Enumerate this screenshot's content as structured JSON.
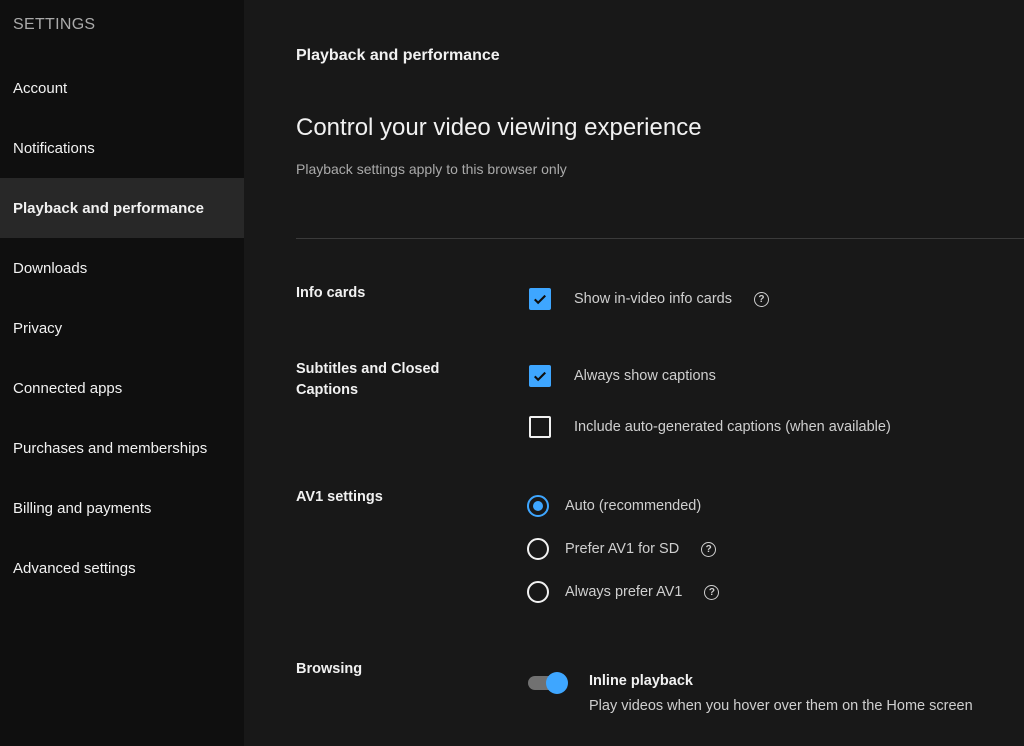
{
  "sidebar": {
    "heading": "SETTINGS",
    "items": [
      {
        "label": "Account"
      },
      {
        "label": "Notifications"
      },
      {
        "label": "Playback and performance"
      },
      {
        "label": "Downloads"
      },
      {
        "label": "Privacy"
      },
      {
        "label": "Connected apps"
      },
      {
        "label": "Purchases and memberships"
      },
      {
        "label": "Billing and payments"
      },
      {
        "label": "Advanced settings"
      }
    ],
    "active_index": 2
  },
  "main": {
    "section_label": "Playback and performance",
    "title": "Control your video viewing experience",
    "subtitle": "Playback settings apply to this browser only",
    "info_cards": {
      "label": "Info cards",
      "option": "Show in-video info cards",
      "checked": true
    },
    "captions": {
      "label": "Subtitles and Closed Captions",
      "always_show": "Always show captions",
      "always_show_checked": true,
      "auto_generated": "Include auto-generated captions (when available)",
      "auto_generated_checked": false
    },
    "av1": {
      "label": "AV1 settings",
      "options": [
        {
          "label": "Auto (recommended)",
          "selected": true
        },
        {
          "label": "Prefer AV1 for SD",
          "selected": false
        },
        {
          "label": "Always prefer AV1",
          "selected": false
        }
      ]
    },
    "browsing": {
      "label": "Browsing",
      "toggle_title": "Inline playback",
      "toggle_desc": "Play videos when you hover over them on the Home screen",
      "toggle_on": true
    }
  },
  "colors": {
    "accent": "#3ea6ff",
    "background": "#181818",
    "sidebar_bg": "#0f0f0f",
    "active_item_bg": "#282828"
  }
}
